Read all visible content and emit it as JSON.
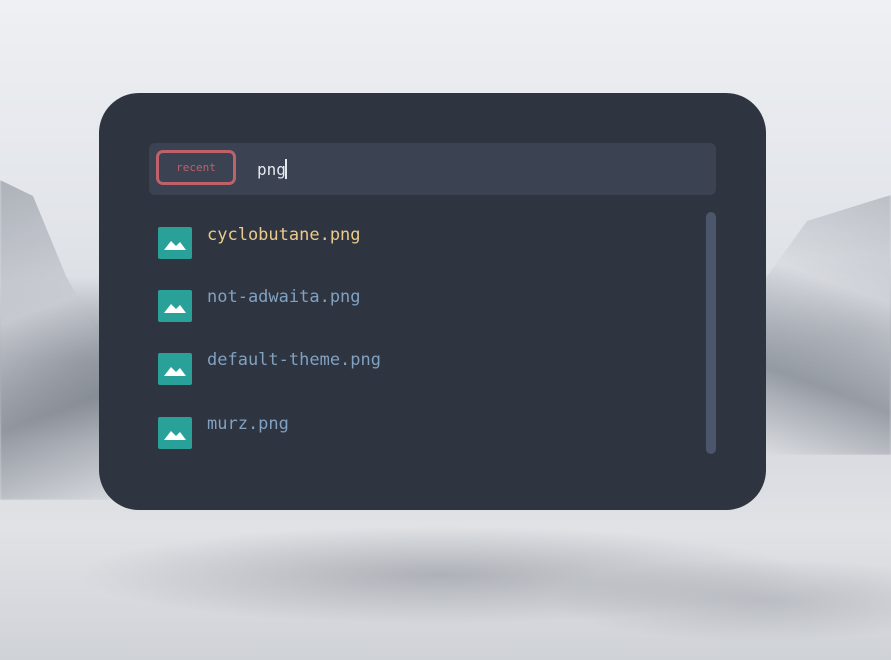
{
  "launcher": {
    "mode_label": "recent",
    "query": "png",
    "results": [
      {
        "name": "cyclobutane.png",
        "icon": "image-file-icon",
        "selected": true
      },
      {
        "name": "not-adwaita.png",
        "icon": "image-file-icon",
        "selected": false
      },
      {
        "name": "default-theme.png",
        "icon": "image-file-icon",
        "selected": false
      },
      {
        "name": "murz.png",
        "icon": "image-file-icon",
        "selected": false
      }
    ]
  },
  "colors": {
    "panel": "#2e3440",
    "search_bar": "#3b4252",
    "mode_border": "#bf616a",
    "selected_text": "#ebcb8b",
    "item_text": "#81a1c1",
    "icon_bg": "#2aa198",
    "scrollbar": "#4c566a"
  }
}
